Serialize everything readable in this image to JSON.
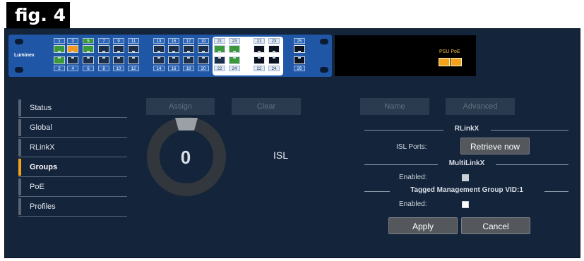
{
  "figure_label": "fig. 4",
  "device": {
    "brand": "Luminex",
    "top_ports": [
      "1",
      "3",
      "5",
      "7",
      "9",
      "11",
      "13",
      "15",
      "17",
      "19",
      "21",
      "23",
      "21",
      "23",
      "25"
    ],
    "bottom_ports": [
      "2",
      "4",
      "6",
      "8",
      "10",
      "12",
      "14",
      "16",
      "18",
      "20",
      "22",
      "24",
      "22",
      "24",
      "26"
    ],
    "psu_label": "PSU PoE"
  },
  "sidebar": {
    "items": [
      {
        "label": "Status"
      },
      {
        "label": "Global"
      },
      {
        "label": "RLinkX"
      },
      {
        "label": "Groups"
      },
      {
        "label": "PoE"
      },
      {
        "label": "Profiles"
      }
    ],
    "active": "Groups"
  },
  "toolbar": {
    "assign_label": "Assign",
    "clear_label": "Clear",
    "name_label": "Name",
    "advanced_label": "Advanced"
  },
  "group": {
    "count": "0",
    "type": "ISL"
  },
  "settings": {
    "rlinkx_title": "RLinkX",
    "isl_ports_label": "ISL Ports:",
    "retrieve_label": "Retrieve now",
    "multilinkx_title": "MultiLinkX",
    "enabled_label": "Enabled:",
    "tagged_title": "Tagged Management Group VID:1",
    "enabled_label_2": "Enabled:",
    "apply_label": "Apply",
    "cancel_label": "Cancel"
  },
  "colors": {
    "background": "#14243a",
    "accent": "#f5a21b",
    "port_green": "#3a9a3a",
    "device_blue": "#1f56a6"
  }
}
